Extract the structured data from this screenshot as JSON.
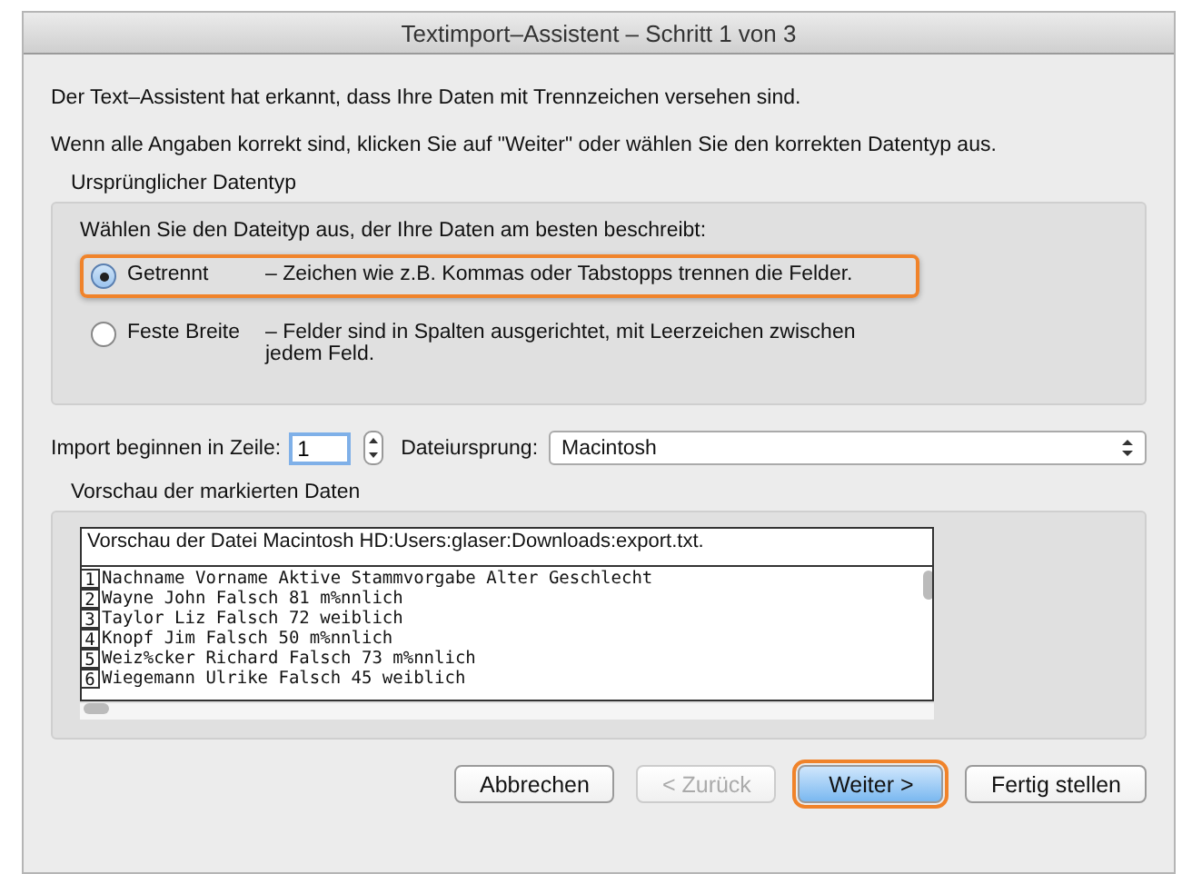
{
  "window": {
    "title": "Textimport–Assistent – Schritt 1 von 3"
  },
  "intro": [
    "Der Text–Assistent hat erkannt, dass Ihre Daten mit Trennzeichen versehen sind.",
    "Wenn alle Angaben korrekt sind, klicken Sie auf \"Weiter\" oder wählen Sie den korrekten Datentyp aus."
  ],
  "datatype_group": {
    "title": "Ursprünglicher Datentyp",
    "prompt": "Wählen Sie den Dateityp aus, der Ihre Daten am besten beschreibt:",
    "options": [
      {
        "label": "Getrennt",
        "description": "– Zeichen wie z.B. Kommas oder Tabstopps trennen die Felder.",
        "selected": true,
        "highlighted": true
      },
      {
        "label": "Feste Breite",
        "description": "– Felder sind in Spalten ausgerichtet, mit Leerzeichen zwischen jedem Feld.",
        "selected": false,
        "highlighted": false
      }
    ]
  },
  "start_row": {
    "label": "Import beginnen in Zeile:",
    "value": "1"
  },
  "origin": {
    "label": "Dateiursprung:",
    "value": "Macintosh"
  },
  "preview": {
    "title": "Vorschau der markierten Daten",
    "header": "Vorschau der Datei Macintosh HD:Users:glaser:Downloads:export.txt.",
    "rows": [
      {
        "number": "1",
        "text": "Nachname Vorname Aktive Stammvorgabe Alter Geschlecht"
      },
      {
        "number": "2",
        "text": "Wayne John Falsch 81 m%nnlich"
      },
      {
        "number": "3",
        "text": "Taylor Liz Falsch 72 weiblich"
      },
      {
        "number": "4",
        "text": "Knopf Jim Falsch 50 m%nnlich"
      },
      {
        "number": "5",
        "text": "Weiz%cker Richard Falsch 73 m%nnlich"
      },
      {
        "number": "6",
        "text": "Wiegemann Ulrike Falsch 45 weiblich"
      }
    ]
  },
  "buttons": [
    {
      "label": "Abbrechen",
      "disabled": false,
      "default": false,
      "highlighted": false
    },
    {
      "label": "< Zurück",
      "disabled": true,
      "default": false,
      "highlighted": false
    },
    {
      "label": "Weiter >",
      "disabled": false,
      "default": true,
      "highlighted": true
    },
    {
      "label": "Fertig stellen",
      "disabled": false,
      "default": false,
      "highlighted": false
    }
  ]
}
